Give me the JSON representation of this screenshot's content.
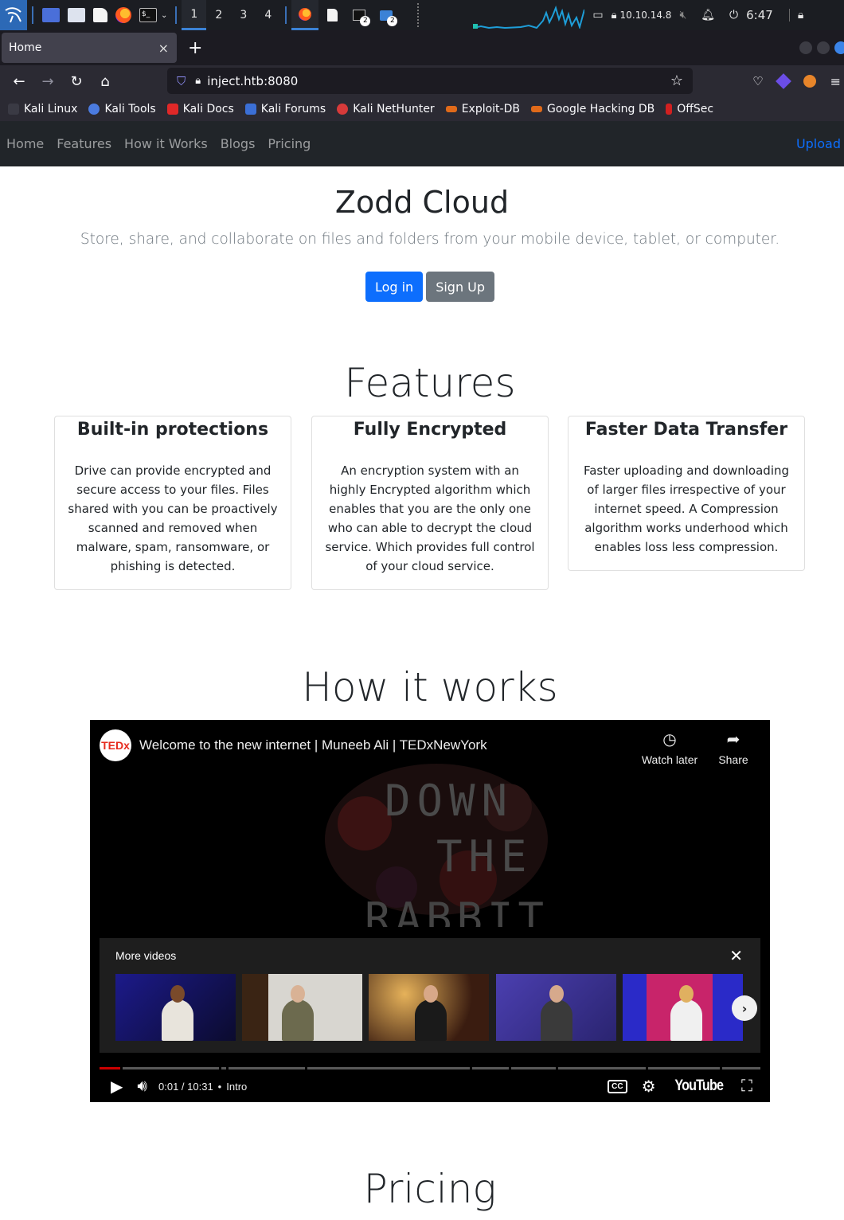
{
  "panel": {
    "workspaces": [
      "1",
      "2",
      "3",
      "4"
    ],
    "active_workspace": "1",
    "badge_count_1": "2",
    "badge_count_2": "2",
    "ip": "10.10.14.8",
    "time": "6:47"
  },
  "browser": {
    "tab_title": "Home",
    "tab_close": "×",
    "new_tab": "+",
    "url": "inject.htb:8080",
    "bookmarks": [
      "Kali Linux",
      "Kali Tools",
      "Kali Docs",
      "Kali Forums",
      "Kali NetHunter",
      "Exploit-DB",
      "Google Hacking DB",
      "OffSec"
    ]
  },
  "site": {
    "nav": [
      "Home",
      "Features",
      "How it Works",
      "Blogs",
      "Pricing"
    ],
    "upload": "Upload",
    "hero_title": "Zodd Cloud",
    "hero_lead": "Store, share, and collaborate on files and folders from your mobile device, tablet, or computer.",
    "login_label": "Log in",
    "signup_label": "Sign Up",
    "features_title": "Features",
    "features": [
      {
        "title": "Built-in protections",
        "text": "Drive can provide encrypted and secure access to your files. Files shared with you can be proactively scanned and removed when malware, spam, ransomware, or phishing is detected."
      },
      {
        "title": "Fully Encrypted",
        "text": "An encryption system with an highly Encrypted algorithm which enables that you are the only one who can able to decrypt the cloud service. Which provides full control of your cloud service."
      },
      {
        "title": "Faster Data Transfer",
        "text": "Faster uploading and downloading of larger files irrespective of your internet speed. A Compression algorithm works underhood which enables loss less compression."
      }
    ],
    "how_title": "How it works",
    "pricing_title": "Pricing"
  },
  "video": {
    "channel_logo": "TEDx",
    "title": "Welcome to the new internet | Muneeb Ali | TEDxNewYork",
    "watch_later": "Watch later",
    "share": "Share",
    "art_text": [
      "DOWN",
      "THE",
      "RABBIT"
    ],
    "more_videos": "More videos",
    "close": "✕",
    "time": "0:01 / 10:31",
    "chapter_sep": "•",
    "chapter": "Intro",
    "cc": "CC",
    "youtube": "YouTube"
  },
  "colors": {
    "primary": "#0d6efd",
    "secondary": "#6c757d",
    "site_nav_bg": "#212529",
    "browser_bg": "#2b2a33"
  }
}
